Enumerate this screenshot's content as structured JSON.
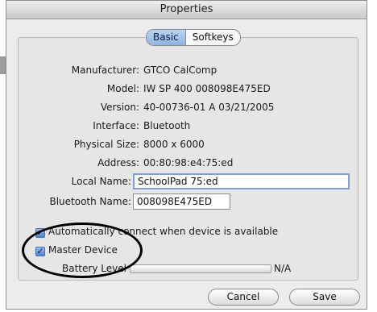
{
  "window": {
    "title": "Properties"
  },
  "tabs": [
    {
      "label": "Basic",
      "active": true
    },
    {
      "label": "Softkeys",
      "active": false
    }
  ],
  "properties": {
    "manufacturer": {
      "label": "Manufacturer:",
      "value": "GTCO CalComp"
    },
    "model": {
      "label": "Model:",
      "value": "IW SP 400 008098E475ED"
    },
    "version": {
      "label": "Version:",
      "value": "40-00736-01 A 03/21/2005"
    },
    "interface": {
      "label": "Interface:",
      "value": "Bluetooth"
    },
    "physical_size": {
      "label": "Physical Size:",
      "value": "8000 x 6000"
    },
    "address": {
      "label": "Address:",
      "value": "00:80:98:e4:75:ed"
    }
  },
  "fields": {
    "local_name": {
      "label": "Local Name:",
      "value": "SchoolPad 75:ed"
    },
    "bluetooth_name": {
      "label": "Bluetooth Name:",
      "value": "008098E475ED"
    }
  },
  "options": {
    "auto_connect": {
      "label": "Automatically connect when device is available",
      "checked": true
    },
    "master_device": {
      "label": "Master Device",
      "checked": true
    }
  },
  "battery": {
    "label": "Battery Level",
    "value_text": "N/A"
  },
  "buttons": {
    "cancel": "Cancel",
    "save": "Save"
  },
  "colors": {
    "accent": "#7ca0d9",
    "annotation": "#000000"
  }
}
